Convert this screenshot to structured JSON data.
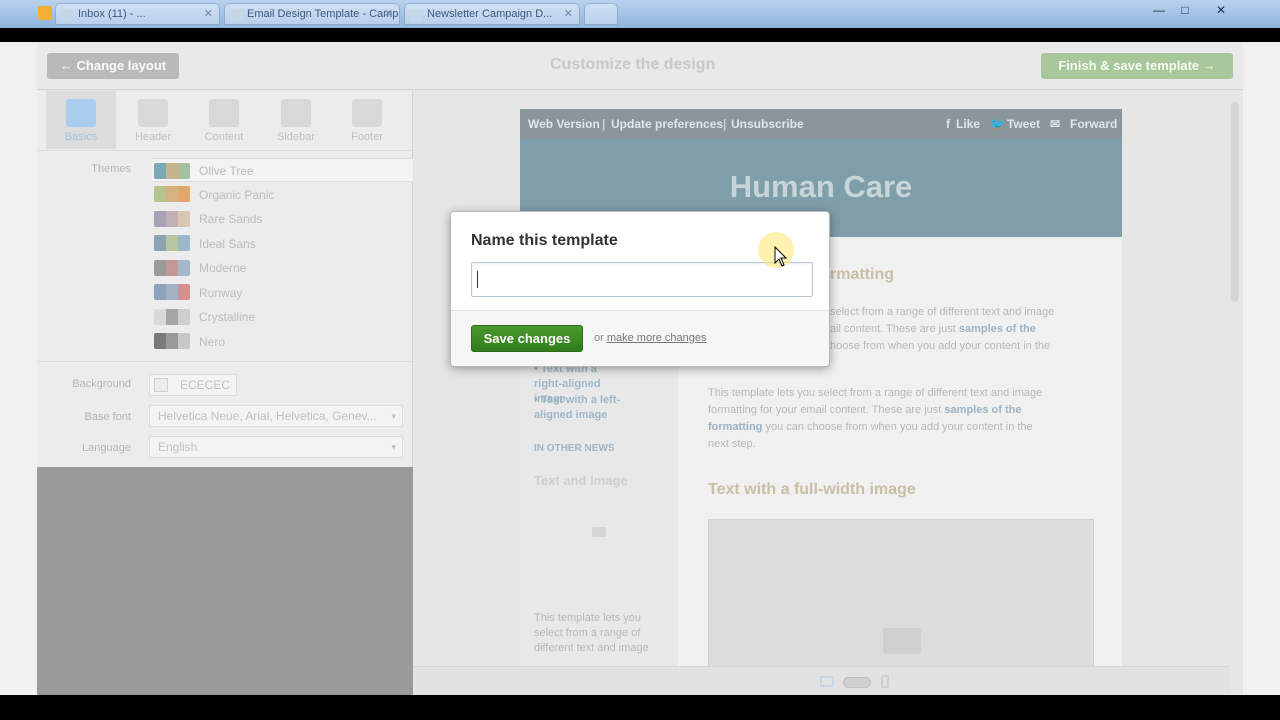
{
  "browser": {
    "tabs": [
      "Inbox (11) - ...",
      "Email Design Template - Campaign M...",
      "Newsletter Campaign D..."
    ],
    "controls": {
      "minimize": "—",
      "maximize": "□",
      "close": "✕"
    }
  },
  "topbar": {
    "change_layout": "← Change layout",
    "title": "Customize the design",
    "finish": "Finish & save template →"
  },
  "left_tabs": [
    "Basics",
    "Header",
    "Content",
    "Sidebar",
    "Footer"
  ],
  "themes": {
    "label": "Themes",
    "items": [
      {
        "name": "Olive Tree",
        "colors": [
          "#7aa9b5",
          "#c8b48a",
          "#a4c0a0"
        ]
      },
      {
        "name": "Organic Panic",
        "colors": [
          "#b5c48e",
          "#d6b27e",
          "#e1a76a"
        ]
      },
      {
        "name": "Rare Sands",
        "colors": [
          "#a7a3b5",
          "#c3b0b6",
          "#d8c7b2"
        ]
      },
      {
        "name": "Ideal Sans",
        "colors": [
          "#8ca3b1",
          "#b7c6a2",
          "#9bb7c9"
        ]
      },
      {
        "name": "Moderne",
        "colors": [
          "#9a9a9a",
          "#c39896",
          "#a4b8cc"
        ]
      },
      {
        "name": "Runway",
        "colors": [
          "#8fa2bd",
          "#a3b1c4",
          "#d4928e"
        ]
      },
      {
        "name": "Crystalline",
        "colors": [
          "#d9d9d9",
          "#a6a6a6",
          "#cfcfcf"
        ]
      },
      {
        "name": "Nero",
        "colors": [
          "#7a7a7a",
          "#9a9a9a",
          "#c8c8c8"
        ]
      }
    ]
  },
  "settings": {
    "background_label": "Background",
    "background_value": "ECECEC",
    "base_font_label": "Base font",
    "base_font_value": "Helvetica Neue, Arial, Helvetica, Genev...",
    "language_label": "Language",
    "language_value": "English"
  },
  "email": {
    "links": {
      "web": "Web Version",
      "prefs": "Update preferences",
      "unsub": "Unsubscribe"
    },
    "social": {
      "like": "Like",
      "tweet": "Tweet",
      "forward": "Forward"
    },
    "title": "Human Care",
    "heading_partial": "rmatting",
    "para1_partial": [
      "select from a range of different text and image",
      "ail content. These are just",
      "samples of the",
      "hoose from when you add your content in the"
    ],
    "side_links": [
      "Text with a right-aligned image",
      "Text with a left-aligned image"
    ],
    "in_other_news": "IN OTHER NEWS",
    "text_and_image": "Text and Image",
    "side_para": "This template lets you select from a range of different text and image",
    "para2": {
      "line1": "This template lets you select from a range of different text and image",
      "line2a": "formatting for your email content. These are just ",
      "line2b": "samples of the",
      "line3a": "formatting",
      "line3b": " you can choose from when you add your content in the",
      "line4": "next step."
    },
    "heading2": "Text with a full-width image"
  },
  "modal": {
    "title": "Name this template",
    "input_value": "",
    "save": "Save changes",
    "or": "or",
    "more": "make more changes"
  },
  "colors": {
    "save_green": "#2f7d1a",
    "accent_blue": "#7e9ea9"
  }
}
